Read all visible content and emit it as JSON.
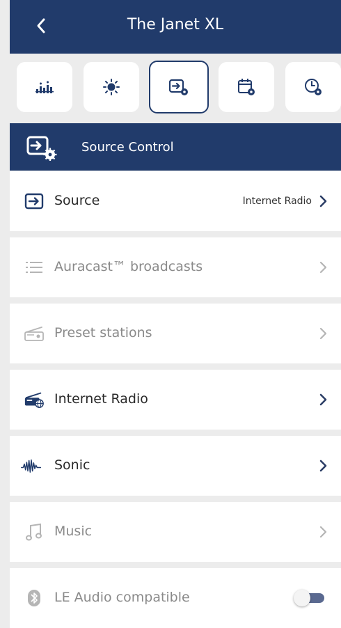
{
  "header": {
    "title": "The Janet XL"
  },
  "tabs": [
    {
      "name": "equalizer-icon",
      "active": false
    },
    {
      "name": "brightness-icon",
      "active": false
    },
    {
      "name": "source-control-icon",
      "active": true
    },
    {
      "name": "calendar-settings-icon",
      "active": false
    },
    {
      "name": "timer-settings-icon",
      "active": false
    }
  ],
  "section": {
    "title": "Source Control"
  },
  "rows": [
    {
      "label": "Source",
      "value": "Internet Radio",
      "icon": "source-icon",
      "enabled": true
    },
    {
      "label": "Auracast™ broadcasts",
      "icon": "list-icon",
      "enabled": false
    },
    {
      "label": "Preset stations",
      "icon": "radio-icon",
      "enabled": false
    },
    {
      "label": "Internet Radio",
      "icon": "internet-radio-icon",
      "enabled": true
    },
    {
      "label": "Sonic",
      "icon": "waveform-icon",
      "enabled": true
    },
    {
      "label": "Music",
      "icon": "music-note-icon",
      "enabled": false
    },
    {
      "label": "LE Audio compatible",
      "icon": "bluetooth-icon",
      "enabled": false,
      "toggle": false
    }
  ],
  "colors": {
    "navy": "#213b6b",
    "background": "#ececec",
    "disabled": "#8a8a8a",
    "chevron_active": "#2c3e66"
  }
}
